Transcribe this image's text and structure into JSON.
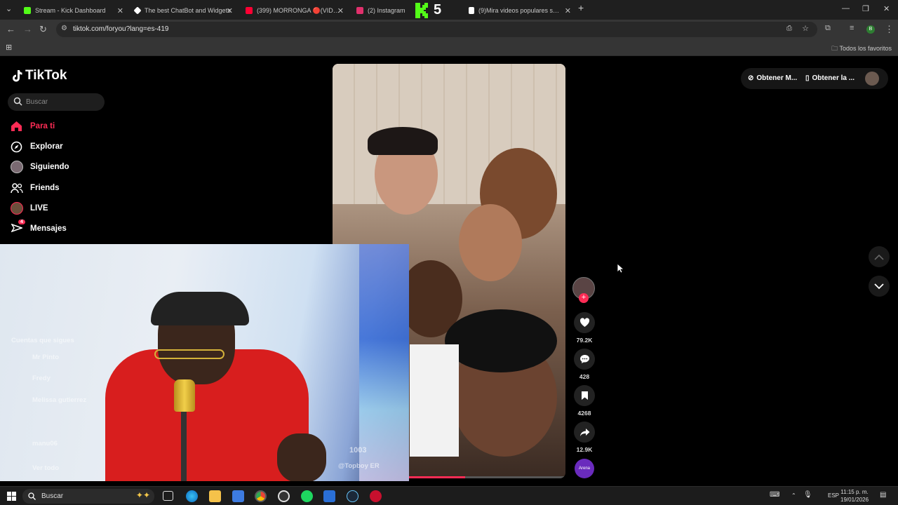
{
  "browser": {
    "tabs": [
      {
        "label": "Stream - Kick Dashboard",
        "favicon_color": "#53fc18"
      },
      {
        "label": "The best ChatBot and Widgets",
        "favicon_color": "#ffffff"
      },
      {
        "label": "(399) MORRONGA 🔴(VIDEO",
        "favicon_color": "#ff0033"
      },
      {
        "label": "(2) Instagram",
        "favicon_color": "#e1306c"
      },
      {
        "label": "(9)Mira videos populares selec",
        "favicon_color": "#ffffff"
      }
    ],
    "new_tab": "+",
    "url": "tiktok.com/foryou?lang=es-419",
    "bookmarks_label": "Todos los favoritos",
    "kick_badge": "5"
  },
  "tiktok": {
    "logo": "TikTok",
    "search_placeholder": "Buscar",
    "nav": [
      {
        "label": "Para ti"
      },
      {
        "label": "Explorar"
      },
      {
        "label": "Siguiendo"
      },
      {
        "label": "Friends"
      },
      {
        "label": "LIVE"
      },
      {
        "label": "Mensajes",
        "badge": "4"
      }
    ],
    "top_buttons": {
      "get_app": "Obtener M...",
      "get_desktop": "Obtener la ..."
    },
    "actions": {
      "likes": "79.2K",
      "comments": "428",
      "saves": "4268",
      "shares": "12.9K",
      "music_label": "Arena"
    },
    "video_progress": 0.57,
    "ghost_sidebar": {
      "following_heading": "Cuentas que sigues",
      "accounts": [
        "Mr Pinto",
        "Fredy",
        "Melissa gutierrez",
        "manu06"
      ],
      "see_all": "Ver todo"
    },
    "overlay_handle": "@Topboy ER",
    "overlay_num": "1003"
  },
  "taskbar": {
    "search_placeholder": "Buscar",
    "lang": "ESP",
    "time": "11:15 p. m.",
    "date": "19/01/2026"
  }
}
